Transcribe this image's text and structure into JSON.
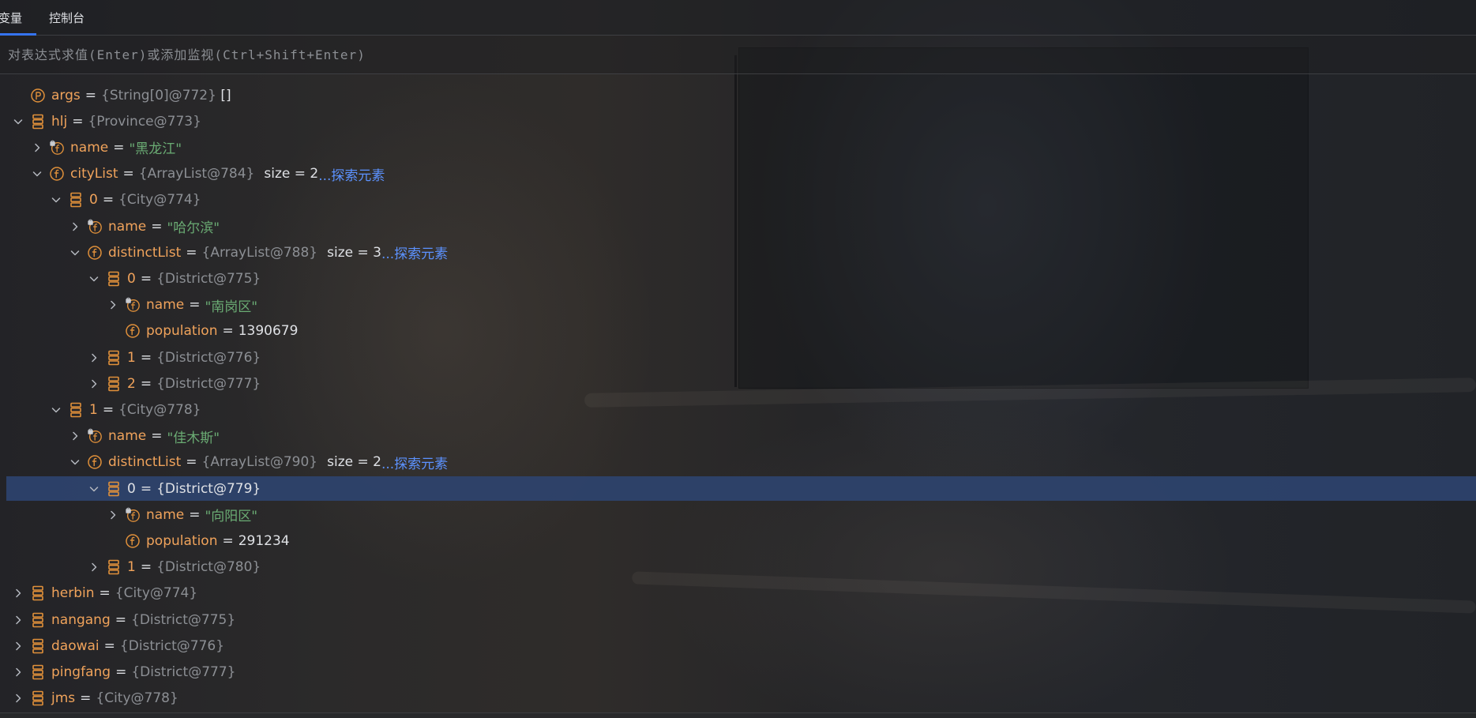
{
  "tabs": [
    {
      "label": "变量",
      "active": true
    },
    {
      "label": "控制台",
      "active": false
    }
  ],
  "evaluate": {
    "placeholder": "对表达式求值(Enter)或添加监视(Ctrl+Shift+Enter)",
    "value": ""
  },
  "colors": {
    "accent": "#3574f0",
    "field_name": "#f0a35b",
    "string_value": "#6aab73",
    "type_value": "#8c8f94",
    "link": "#5c92ff",
    "selection": "#2e436e",
    "icon_orange": "#e0903a"
  },
  "tree": [
    {
      "depth": 0,
      "arrow": "none",
      "icon": "parameter-icon",
      "name": "args",
      "value": "{String[0]@772}",
      "value_kind": "type",
      "extra": " []"
    },
    {
      "depth": 0,
      "arrow": "expanded",
      "icon": "object-icon",
      "name": "hlj",
      "value": "{Province@773}",
      "value_kind": "type"
    },
    {
      "depth": 1,
      "arrow": "collapsed",
      "icon": "field-lock-icon",
      "name": "name",
      "value": "\"黑龙江\"",
      "value_kind": "string"
    },
    {
      "depth": 1,
      "arrow": "expanded",
      "icon": "field-icon",
      "name": "cityList",
      "value": "{ArrayList@784}",
      "value_kind": "type",
      "size": "size = 2",
      "link": "...探索元素"
    },
    {
      "depth": 2,
      "arrow": "expanded",
      "icon": "object-icon",
      "name": "0",
      "value": "{City@774}",
      "value_kind": "type"
    },
    {
      "depth": 3,
      "arrow": "collapsed",
      "icon": "field-lock-icon",
      "name": "name",
      "value": "\"哈尔滨\"",
      "value_kind": "string"
    },
    {
      "depth": 3,
      "arrow": "expanded",
      "icon": "field-icon",
      "name": "distinctList",
      "value": "{ArrayList@788}",
      "value_kind": "type",
      "size": "size = 3",
      "link": "...探索元素"
    },
    {
      "depth": 4,
      "arrow": "expanded",
      "icon": "object-icon",
      "name": "0",
      "value": "{District@775}",
      "value_kind": "type"
    },
    {
      "depth": 5,
      "arrow": "collapsed",
      "icon": "field-lock-icon",
      "name": "name",
      "value": "\"南岗区\"",
      "value_kind": "string"
    },
    {
      "depth": 5,
      "arrow": "none",
      "icon": "field-icon",
      "name": "population",
      "value": "1390679",
      "value_kind": "number"
    },
    {
      "depth": 4,
      "arrow": "collapsed",
      "icon": "object-icon",
      "name": "1",
      "value": "{District@776}",
      "value_kind": "type"
    },
    {
      "depth": 4,
      "arrow": "collapsed",
      "icon": "object-icon",
      "name": "2",
      "value": "{District@777}",
      "value_kind": "type"
    },
    {
      "depth": 2,
      "arrow": "expanded",
      "icon": "object-icon",
      "name": "1",
      "value": "{City@778}",
      "value_kind": "type"
    },
    {
      "depth": 3,
      "arrow": "collapsed",
      "icon": "field-lock-icon",
      "name": "name",
      "value": "\"佳木斯\"",
      "value_kind": "string"
    },
    {
      "depth": 3,
      "arrow": "expanded",
      "icon": "field-icon",
      "name": "distinctList",
      "value": "{ArrayList@790}",
      "value_kind": "type",
      "size": "size = 2",
      "link": "...探索元素"
    },
    {
      "depth": 4,
      "arrow": "expanded",
      "icon": "object-icon",
      "name": "0",
      "value": "{District@779}",
      "value_kind": "type",
      "selected": true
    },
    {
      "depth": 5,
      "arrow": "collapsed",
      "icon": "field-lock-icon",
      "name": "name",
      "value": "\"向阳区\"",
      "value_kind": "string"
    },
    {
      "depth": 5,
      "arrow": "none",
      "icon": "field-icon",
      "name": "population",
      "value": "291234",
      "value_kind": "number"
    },
    {
      "depth": 4,
      "arrow": "collapsed",
      "icon": "object-icon",
      "name": "1",
      "value": "{District@780}",
      "value_kind": "type"
    },
    {
      "depth": 0,
      "arrow": "collapsed",
      "icon": "object-icon",
      "name": "herbin",
      "value": "{City@774}",
      "value_kind": "type"
    },
    {
      "depth": 0,
      "arrow": "collapsed",
      "icon": "object-icon",
      "name": "nangang",
      "value": "{District@775}",
      "value_kind": "type"
    },
    {
      "depth": 0,
      "arrow": "collapsed",
      "icon": "object-icon",
      "name": "daowai",
      "value": "{District@776}",
      "value_kind": "type"
    },
    {
      "depth": 0,
      "arrow": "collapsed",
      "icon": "object-icon",
      "name": "pingfang",
      "value": "{District@777}",
      "value_kind": "type"
    },
    {
      "depth": 0,
      "arrow": "collapsed",
      "icon": "object-icon",
      "name": "jms",
      "value": "{City@778}",
      "value_kind": "type"
    }
  ]
}
